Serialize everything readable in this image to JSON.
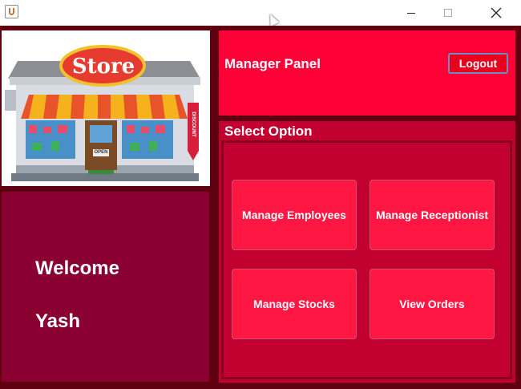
{
  "window": {
    "title": "",
    "controls": {
      "minimize": "minimize-icon",
      "maximize": "maximize-icon",
      "close": "close-icon"
    }
  },
  "store_image": {
    "sign_text": "Store",
    "side_banner": "DISCOUNT",
    "door_sign": "OPEN"
  },
  "header": {
    "title": "Manager Panel",
    "logout_label": "Logout"
  },
  "options": {
    "title": "Select Option",
    "buttons": [
      {
        "label": "Manage Employees"
      },
      {
        "label": "Manage Receptionist"
      },
      {
        "label": "Manage Stocks"
      },
      {
        "label": "View Orders"
      }
    ]
  },
  "welcome": {
    "greeting": "Welcome",
    "user_name": "Yash"
  },
  "colors": {
    "frame": "#5e0010",
    "header_bg": "#ff0037",
    "options_bg": "#c2002f",
    "button_bg": "#ff1744",
    "welcome_bg": "#8a0030"
  }
}
